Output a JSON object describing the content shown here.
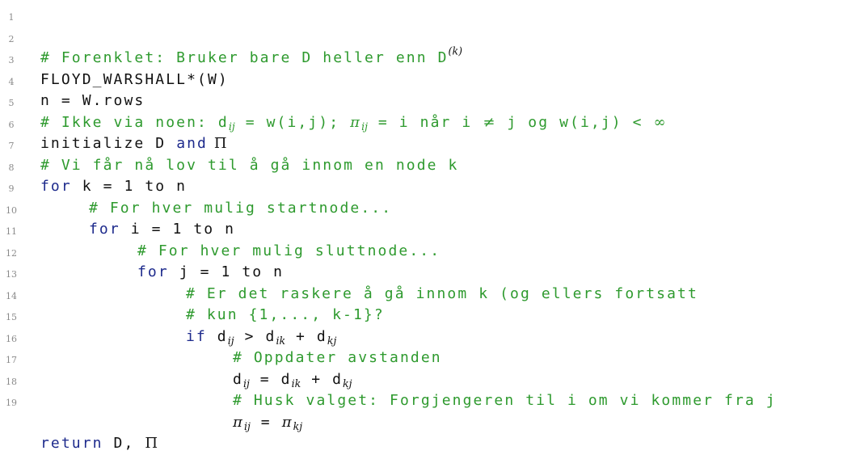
{
  "lines": [
    {
      "n": "1",
      "p": {
        "c1": "# Forenklet: Bruker bare D heller enn D",
        "k": "(k)"
      }
    },
    {
      "n": "2",
      "p": {
        "t": "FLOYD_WARSHALL*(W)"
      }
    },
    {
      "n": "3",
      "p": {
        "t": "n = W.rows"
      }
    },
    {
      "n": "4",
      "p": {
        "c1": "# Ikke via noen: d",
        "s1": "ij",
        "c2": " = w(i,j); ",
        "pi": "π",
        "s2": "ij",
        "c3": " = i når i ",
        "ne": "≠",
        "c4": " j og w(i,j) < ",
        "inf": "∞"
      }
    },
    {
      "n": "5",
      "p": {
        "t1": "initialize D ",
        "and": "and",
        "Pi": " Π"
      }
    },
    {
      "n": "6",
      "p": {
        "c": "# Vi får nå lov til å gå innom en node k"
      }
    },
    {
      "n": "7",
      "p": {
        "kw": "for",
        "t": " k = 1 to n"
      }
    },
    {
      "n": "8",
      "p": {
        "c": "# For hver mulig startnode..."
      }
    },
    {
      "n": "9",
      "p": {
        "kw": "for",
        "t": " i = 1 to n"
      }
    },
    {
      "n": "10",
      "p": {
        "c": "# For hver mulig sluttnode..."
      }
    },
    {
      "n": "11",
      "p": {
        "kw": "for",
        "t": " j = 1 to n"
      }
    },
    {
      "n": "12",
      "p": {
        "c": "# Er det raskere å gå innom k (og ellers fortsatt"
      }
    },
    {
      "n": "13",
      "p": {
        "c": "# kun {1,..., k-1}?"
      }
    },
    {
      "n": "14",
      "p": {
        "kw": "if",
        "d1": " d",
        "s1": "ij",
        "t1": " > d",
        "s2": "ik",
        "t2": " + d",
        "s3": "kj"
      }
    },
    {
      "n": "15",
      "p": {
        "c": "# Oppdater avstanden"
      }
    },
    {
      "n": "16",
      "p": {
        "d1": "d",
        "s1": "ij",
        "t1": " = d",
        "s2": "ik",
        "t2": " + d",
        "s3": "kj"
      }
    },
    {
      "n": "17",
      "p": {
        "c": "# Husk valget: Forgjengeren til i om vi kommer fra j"
      }
    },
    {
      "n": "18",
      "p": {
        "pi1": "π",
        "s1": "ij",
        "t1": " = ",
        "pi2": "π",
        "s2": "kj"
      }
    },
    {
      "n": "19",
      "p": {
        "kw": "return",
        "t": " D, ",
        "Pi": "Π"
      }
    }
  ]
}
